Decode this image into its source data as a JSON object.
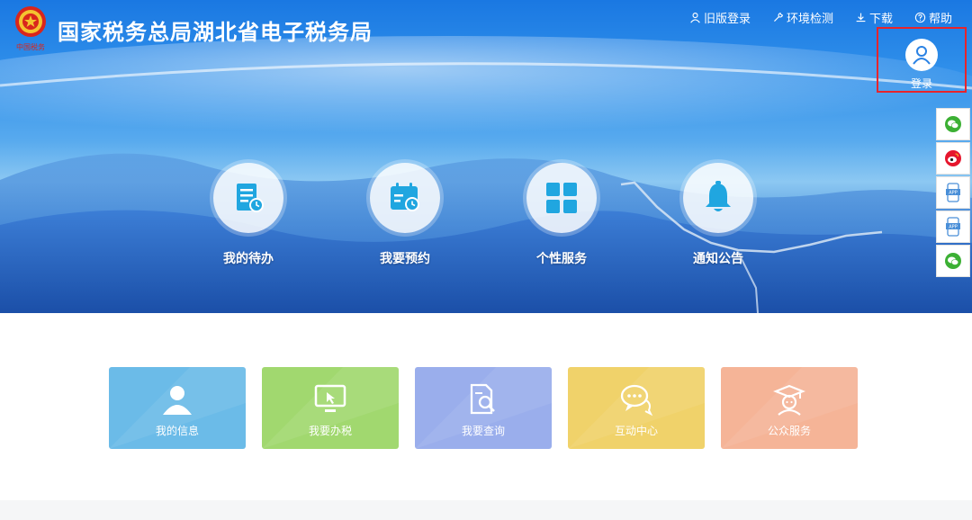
{
  "header": {
    "logo_text": "中国税务",
    "title": "国家税务总局湖北省电子税务局",
    "links": [
      {
        "icon": "user-icon",
        "label": "旧版登录"
      },
      {
        "icon": "wrench-icon",
        "label": "环境检测"
      },
      {
        "icon": "download-icon",
        "label": "下载"
      },
      {
        "icon": "question-circle-icon",
        "label": "帮助"
      }
    ],
    "login_label": "登录"
  },
  "sidebar": {
    "items": [
      {
        "icon": "wechat-icon",
        "color": "#3cb034"
      },
      {
        "icon": "weibo-icon",
        "color": "#e6162d"
      },
      {
        "icon": "app-icon",
        "color": "#4a8fd8"
      },
      {
        "icon": "app-icon",
        "color": "#4a8fd8"
      },
      {
        "icon": "wechat-icon",
        "color": "#3cb034"
      }
    ]
  },
  "quick_menu": [
    {
      "icon": "todo-icon",
      "label": "我的待办"
    },
    {
      "icon": "calendar-icon",
      "label": "我要预约"
    },
    {
      "icon": "grid-icon",
      "label": "个性服务"
    },
    {
      "icon": "bell-icon",
      "label": "通知公告"
    }
  ],
  "tiles": [
    {
      "icon": "person-icon",
      "label": "我的信息",
      "color": "#6bbbe8"
    },
    {
      "icon": "monitor-icon",
      "label": "我要办税",
      "color": "#a1d86f"
    },
    {
      "icon": "search-doc-icon",
      "label": "我要查询",
      "color": "#9aaeec"
    },
    {
      "icon": "chat-icon",
      "label": "互动中心",
      "color": "#f0d26a"
    },
    {
      "icon": "scholar-icon",
      "label": "公众服务",
      "color": "#f5b497"
    }
  ],
  "colors": {
    "accent": "#1a78e2",
    "icon_blue": "#20a6e0",
    "login_border": "#e8242b"
  }
}
